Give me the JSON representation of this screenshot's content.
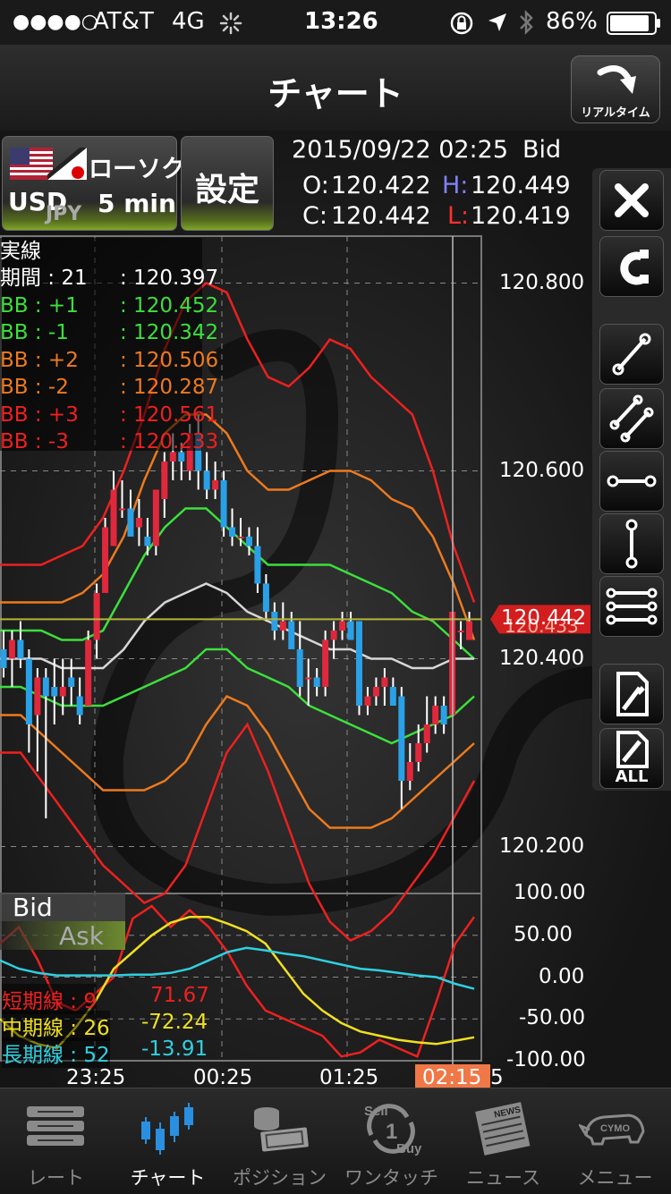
{
  "status_bar": {
    "signal": "●●●●○",
    "carrier": "AT&T",
    "network": "4G",
    "time": "13:26",
    "battery": "86%"
  },
  "nav": {
    "title": "チャート",
    "realtime_label": "リアルタイム"
  },
  "pair_button": {
    "chart_type": "ローソク",
    "base": "USD",
    "quote": "JPY",
    "interval": "5 min"
  },
  "settings_button": {
    "label": "設定"
  },
  "ohlc": {
    "datetime": "2015/09/22 02:25",
    "side": "Bid",
    "open_label": "O:",
    "open": "120.422",
    "high_label": "H:",
    "high": "120.449",
    "close_label": "C:",
    "close": "120.442",
    "low_label": "L:",
    "low": "120.419"
  },
  "legend": {
    "title": "実線",
    "rows": [
      {
        "label": "期間 : 21",
        "value": ": 120.397",
        "color": "#ffffff"
      },
      {
        "label": "BB : +1",
        "value": ": 120.452",
        "color": "#3ce03c"
      },
      {
        "label": "BB : -1",
        "value": ": 120.342",
        "color": "#3ce03c"
      },
      {
        "label": "BB : +2",
        "value": ": 120.506",
        "color": "#ee7a1e"
      },
      {
        "label": "BB : -2",
        "value": ": 120.287",
        "color": "#ee7a1e"
      },
      {
        "label": "BB : +3",
        "value": ": 120.561",
        "color": "#ee2020"
      },
      {
        "label": "BB : -3",
        "value": ": 120.233",
        "color": "#ee2020"
      }
    ]
  },
  "price_axis": [
    "120.800",
    "120.600",
    "120.400",
    "120.200"
  ],
  "current_price": "120.442",
  "current_price_ghost": "120.433",
  "osc_axis": [
    "100.00",
    "50.00",
    "0.00",
    "-50.00",
    "-100.00"
  ],
  "time_axis": [
    "23:25",
    "00:25",
    "01:25"
  ],
  "cursor_time": "02:15",
  "cursor_time_suffix": "5",
  "bid_label": "Bid",
  "ask_label": "Ask",
  "oscillator_legend": [
    {
      "label": "短期線 : 9",
      "value": "71.67",
      "color": "#ee2020"
    },
    {
      "label": "中期線 : 26",
      "value": "-72.24",
      "color": "#f0e020"
    },
    {
      "label": "長期線 : 52",
      "value": "-13.91",
      "color": "#30d0e0"
    }
  ],
  "right_panel": {
    "tools": [
      "close-icon",
      "magnet-icon",
      "trendline-icon",
      "parallel-lines-icon",
      "horizontal-line-icon",
      "vertical-line-icon",
      "multi-horizontal-lines-icon",
      "delete-icon",
      "delete-all-icon"
    ],
    "delete_all_label": "ALL"
  },
  "tabs": [
    {
      "label": "レート",
      "icon": "rate-list-icon",
      "active": false
    },
    {
      "label": "チャート",
      "icon": "candlestick-chart-icon",
      "active": true
    },
    {
      "label": "ポジション",
      "icon": "money-stack-icon",
      "active": false
    },
    {
      "label": "ワンタッチ",
      "icon": "sell-buy-icon",
      "active": false
    },
    {
      "label": "ニュース",
      "icon": "newspaper-icon",
      "active": false
    },
    {
      "label": "メニュー",
      "icon": "cymo-rhino-icon",
      "active": false
    }
  ],
  "tab_icon_texts": {
    "sell": "Sell",
    "one": "1",
    "buy": "Buy",
    "news": "NEWS",
    "cymo": "CYMO"
  },
  "colors": {
    "active_tab": "#2a8fe0",
    "inactive_tab": "#8a8a8a",
    "candle_up": "#e0283c",
    "candle_down": "#2aa0e6",
    "price_tag": "#d21e1e",
    "cursor_tag": "#f07846"
  },
  "chart_data": {
    "type": "candlestick",
    "interval": "5 min",
    "pair": "USD/JPY",
    "price_ylim": [
      120.15,
      120.85
    ],
    "price_ticks": [
      120.2,
      120.4,
      120.6,
      120.8
    ],
    "osc_ylim": [
      -100,
      100
    ],
    "time_ticks": [
      "23:25",
      "00:25",
      "01:25",
      "02:15"
    ],
    "candles": [
      {
        "o": 120.41,
        "h": 120.43,
        "l": 120.38,
        "c": 120.39
      },
      {
        "o": 120.4,
        "h": 120.43,
        "l": 120.37,
        "c": 120.42
      },
      {
        "o": 120.42,
        "h": 120.44,
        "l": 120.39,
        "c": 120.4
      },
      {
        "o": 120.4,
        "h": 120.41,
        "l": 120.3,
        "c": 120.33
      },
      {
        "o": 120.34,
        "h": 120.39,
        "l": 120.28,
        "c": 120.38
      },
      {
        "o": 120.38,
        "h": 120.39,
        "l": 120.23,
        "c": 120.36
      },
      {
        "o": 120.37,
        "h": 120.4,
        "l": 120.33,
        "c": 120.36
      },
      {
        "o": 120.36,
        "h": 120.4,
        "l": 120.34,
        "c": 120.37
      },
      {
        "o": 120.38,
        "h": 120.4,
        "l": 120.35,
        "c": 120.37
      },
      {
        "o": 120.36,
        "h": 120.38,
        "l": 120.33,
        "c": 120.34
      },
      {
        "o": 120.35,
        "h": 120.43,
        "l": 120.35,
        "c": 120.42
      },
      {
        "o": 120.42,
        "h": 120.48,
        "l": 120.4,
        "c": 120.47
      },
      {
        "o": 120.47,
        "h": 120.55,
        "l": 120.47,
        "c": 120.54
      },
      {
        "o": 120.52,
        "h": 120.6,
        "l": 120.52,
        "c": 120.58
      },
      {
        "o": 120.56,
        "h": 120.59,
        "l": 120.55,
        "c": 120.56
      },
      {
        "o": 120.56,
        "h": 120.58,
        "l": 120.53,
        "c": 120.53
      },
      {
        "o": 120.54,
        "h": 120.57,
        "l": 120.52,
        "c": 120.55
      },
      {
        "o": 120.53,
        "h": 120.55,
        "l": 120.51,
        "c": 120.52
      },
      {
        "o": 120.52,
        "h": 120.58,
        "l": 120.51,
        "c": 120.58
      },
      {
        "o": 120.57,
        "h": 120.62,
        "l": 120.55,
        "c": 120.61
      },
      {
        "o": 120.61,
        "h": 120.64,
        "l": 120.59,
        "c": 120.62
      },
      {
        "o": 120.62,
        "h": 120.63,
        "l": 120.59,
        "c": 120.61
      },
      {
        "o": 120.6,
        "h": 120.65,
        "l": 120.59,
        "c": 120.64
      },
      {
        "o": 120.64,
        "h": 120.66,
        "l": 120.58,
        "c": 120.6
      },
      {
        "o": 120.6,
        "h": 120.62,
        "l": 120.57,
        "c": 120.58
      },
      {
        "o": 120.58,
        "h": 120.61,
        "l": 120.57,
        "c": 120.59
      },
      {
        "o": 120.59,
        "h": 120.6,
        "l": 120.53,
        "c": 120.54
      },
      {
        "o": 120.54,
        "h": 120.56,
        "l": 120.52,
        "c": 120.53
      },
      {
        "o": 120.53,
        "h": 120.55,
        "l": 120.52,
        "c": 120.53
      },
      {
        "o": 120.53,
        "h": 120.54,
        "l": 120.51,
        "c": 120.52
      },
      {
        "o": 120.52,
        "h": 120.54,
        "l": 120.47,
        "c": 120.48
      },
      {
        "o": 120.48,
        "h": 120.49,
        "l": 120.44,
        "c": 120.45
      },
      {
        "o": 120.45,
        "h": 120.46,
        "l": 120.42,
        "c": 120.43
      },
      {
        "o": 120.43,
        "h": 120.46,
        "l": 120.42,
        "c": 120.44
      },
      {
        "o": 120.44,
        "h": 120.45,
        "l": 120.41,
        "c": 120.41
      },
      {
        "o": 120.41,
        "h": 120.44,
        "l": 120.36,
        "c": 120.37
      },
      {
        "o": 120.38,
        "h": 120.4,
        "l": 120.35,
        "c": 120.38
      },
      {
        "o": 120.38,
        "h": 120.39,
        "l": 120.36,
        "c": 120.37
      },
      {
        "o": 120.37,
        "h": 120.43,
        "l": 120.36,
        "c": 120.42
      },
      {
        "o": 120.42,
        "h": 120.44,
        "l": 120.4,
        "c": 120.43
      },
      {
        "o": 120.43,
        "h": 120.45,
        "l": 120.42,
        "c": 120.44
      },
      {
        "o": 120.44,
        "h": 120.45,
        "l": 120.42,
        "c": 120.42
      },
      {
        "o": 120.44,
        "h": 120.44,
        "l": 120.34,
        "c": 120.35
      },
      {
        "o": 120.35,
        "h": 120.37,
        "l": 120.34,
        "c": 120.36
      },
      {
        "o": 120.36,
        "h": 120.38,
        "l": 120.35,
        "c": 120.37
      },
      {
        "o": 120.37,
        "h": 120.39,
        "l": 120.35,
        "c": 120.38
      },
      {
        "o": 120.37,
        "h": 120.38,
        "l": 120.35,
        "c": 120.35
      },
      {
        "o": 120.36,
        "h": 120.37,
        "l": 120.24,
        "c": 120.27
      },
      {
        "o": 120.27,
        "h": 120.31,
        "l": 120.26,
        "c": 120.29
      },
      {
        "o": 120.29,
        "h": 120.33,
        "l": 120.28,
        "c": 120.31
      },
      {
        "o": 120.31,
        "h": 120.36,
        "l": 120.3,
        "c": 120.33
      },
      {
        "o": 120.33,
        "h": 120.36,
        "l": 120.32,
        "c": 120.35
      },
      {
        "o": 120.35,
        "h": 120.36,
        "l": 120.32,
        "c": 120.33
      },
      {
        "o": 120.34,
        "h": 120.45,
        "l": 120.34,
        "c": 120.45
      },
      {
        "o": 120.43,
        "h": 120.44,
        "l": 120.41,
        "c": 120.43
      },
      {
        "o": 120.42,
        "h": 120.45,
        "l": 120.42,
        "c": 120.44
      }
    ],
    "series": [
      {
        "name": "BB : +3",
        "color": "#ee2020",
        "values": [
          120.5,
          120.5,
          120.5,
          120.51,
          120.52,
          120.55,
          120.6,
          120.66,
          120.73,
          120.78,
          120.8,
          120.79,
          120.74,
          120.7,
          120.69,
          120.71,
          120.74,
          120.73,
          120.7,
          120.68,
          120.66,
          120.6,
          120.52,
          120.46
        ]
      },
      {
        "name": "BB : +2",
        "color": "#ee7a1e",
        "values": [
          120.46,
          120.46,
          120.46,
          120.46,
          120.47,
          120.49,
          120.53,
          120.59,
          120.64,
          120.66,
          120.66,
          120.64,
          120.6,
          120.58,
          120.58,
          120.59,
          120.6,
          120.6,
          120.59,
          120.57,
          120.56,
          120.53,
          120.48,
          120.42
        ]
      },
      {
        "name": "BB : +1",
        "color": "#3ce03c",
        "values": [
          120.43,
          120.43,
          120.43,
          120.42,
          120.42,
          120.43,
          120.47,
          120.51,
          120.54,
          120.56,
          120.56,
          120.54,
          120.52,
          120.5,
          120.5,
          120.5,
          120.5,
          120.49,
          120.48,
          120.47,
          120.45,
          120.44,
          120.42,
          120.4
        ]
      },
      {
        "name": "期間 : 21",
        "color": "#d8d8d8",
        "values": [
          120.4,
          120.4,
          120.4,
          120.39,
          120.39,
          120.39,
          120.41,
          120.44,
          120.46,
          120.47,
          120.48,
          120.47,
          120.45,
          120.44,
          120.43,
          120.42,
          120.41,
          120.41,
          120.4,
          120.4,
          120.39,
          120.39,
          120.4,
          120.4
        ]
      },
      {
        "name": "BB : -1",
        "color": "#3ce03c",
        "values": [
          120.37,
          120.37,
          120.36,
          120.35,
          120.35,
          120.35,
          120.36,
          120.37,
          120.38,
          120.39,
          120.41,
          120.41,
          120.39,
          120.38,
          120.37,
          120.35,
          120.34,
          120.33,
          120.32,
          120.31,
          120.32,
          120.33,
          120.34,
          120.36
        ]
      },
      {
        "name": "BB : -2",
        "color": "#ee7a1e",
        "values": [
          120.34,
          120.34,
          120.32,
          120.3,
          120.28,
          120.26,
          120.26,
          120.26,
          120.27,
          120.29,
          120.33,
          120.36,
          120.35,
          120.32,
          120.28,
          120.24,
          120.22,
          120.22,
          120.22,
          120.23,
          120.25,
          120.27,
          120.29,
          120.31
        ]
      },
      {
        "name": "BB : -3",
        "color": "#ee2020",
        "values": [
          120.3,
          120.3,
          120.27,
          120.24,
          120.21,
          120.18,
          120.16,
          120.14,
          120.15,
          120.18,
          120.24,
          120.3,
          120.33,
          120.28,
          120.22,
          120.16,
          120.12,
          120.1,
          120.11,
          120.13,
          120.16,
          120.19,
          120.23,
          120.27
        ]
      }
    ],
    "oscillator": [
      {
        "name": "短期線 : 9",
        "color": "#ee2020",
        "values": [
          40,
          60,
          20,
          -30,
          -40,
          -20,
          0,
          70,
          85,
          60,
          80,
          60,
          30,
          -10,
          -40,
          -50,
          -60,
          -70,
          -95,
          -90,
          -75,
          -85,
          -95,
          -30,
          40,
          72
        ]
      },
      {
        "name": "中期線 : 26",
        "color": "#f0e020",
        "values": [
          -50,
          -70,
          -80,
          -85,
          -60,
          -30,
          10,
          30,
          50,
          65,
          72,
          72,
          64,
          55,
          40,
          10,
          -20,
          -40,
          -55,
          -65,
          -70,
          -75,
          -78,
          -80,
          -76,
          -72
        ]
      },
      {
        "name": "長期線 : 52",
        "color": "#30d0e0",
        "values": [
          20,
          10,
          5,
          2,
          2,
          2,
          2,
          3,
          3,
          5,
          10,
          20,
          30,
          35,
          32,
          28,
          25,
          20,
          15,
          10,
          8,
          5,
          2,
          0,
          -8,
          -14
        ]
      }
    ]
  }
}
